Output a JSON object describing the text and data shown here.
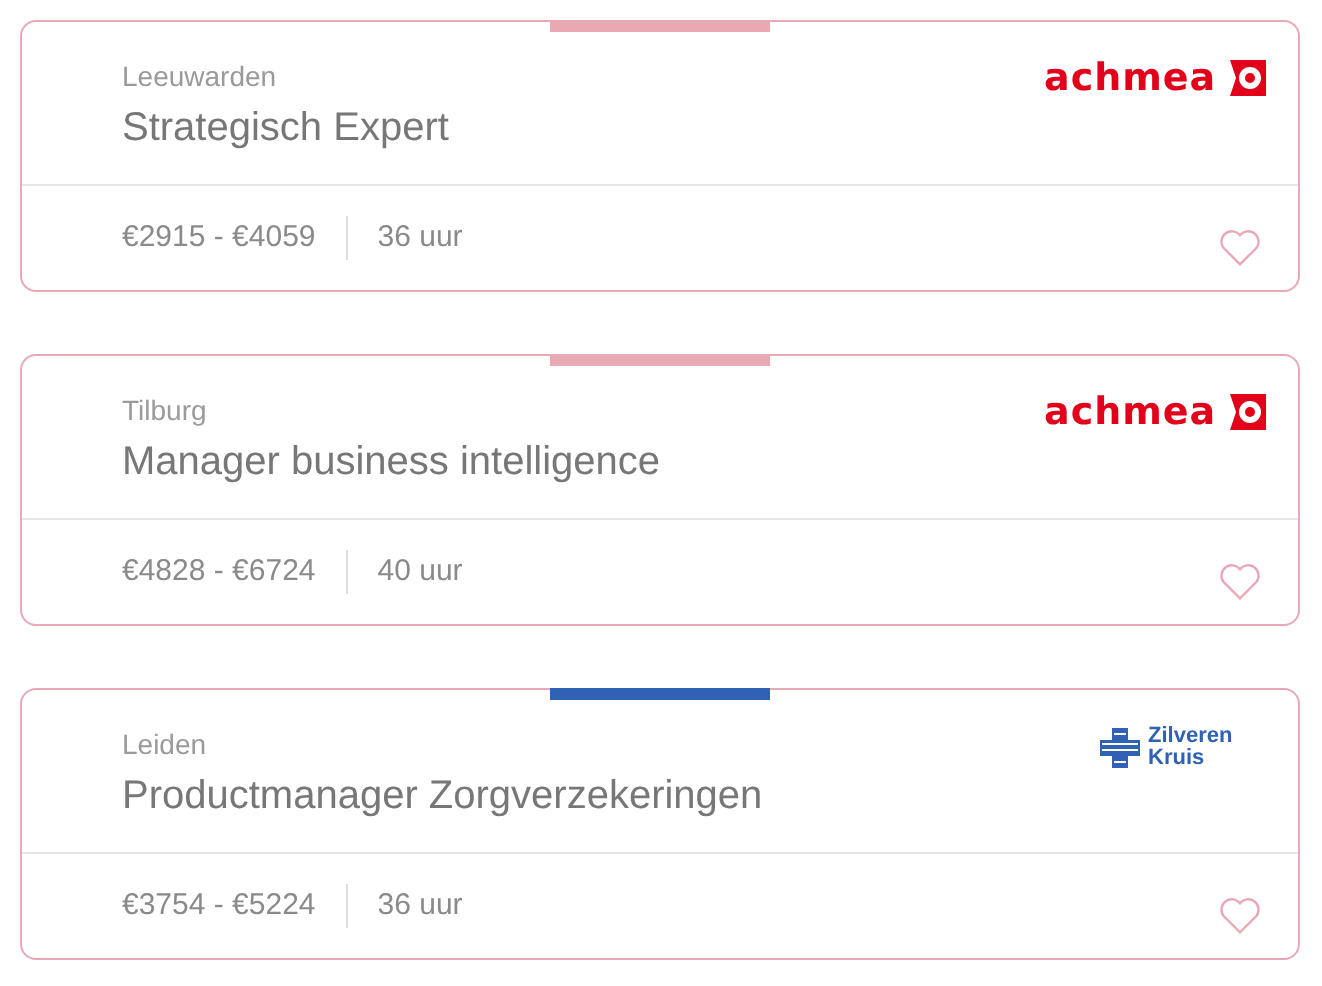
{
  "jobs": [
    {
      "city": "Leeuwarden",
      "title": "Strategisch Expert",
      "salary": "€2915 - €4059",
      "hours": "36 uur",
      "color": "#e8a9b2",
      "logo": {
        "kind": "achmea",
        "text": "achmea"
      },
      "favorite": false
    },
    {
      "city": "Tilburg",
      "title": "Manager business intelligence",
      "salary": "€4828 - €6724",
      "hours": "40 uur",
      "color": "#e8a9b2",
      "logo": {
        "kind": "achmea",
        "text": "achmea"
      },
      "favorite": false
    },
    {
      "city": "Leiden",
      "title": "Productmanager Zorgverzekeringen",
      "salary": "€3754 - €5224",
      "hours": "36 uur",
      "color": "#2f62b5",
      "logo": {
        "kind": "zilveren",
        "text": "Zilveren Kruis"
      },
      "favorite": false
    }
  ]
}
